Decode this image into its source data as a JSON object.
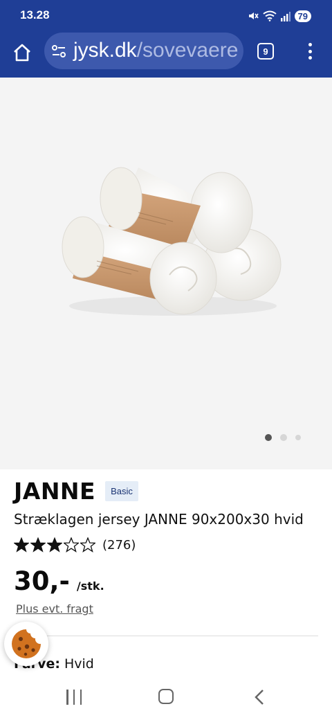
{
  "status_bar": {
    "time": "13.28",
    "battery": "79",
    "icons": [
      "mute-icon",
      "wifi-icon",
      "signal-icon",
      "battery-icon"
    ]
  },
  "browser": {
    "url_domain": "jysk.dk",
    "url_path": "/sovevaere",
    "tab_count": "9",
    "icons": [
      "home-icon",
      "site-settings-icon",
      "tabs-icon",
      "more-menu-icon"
    ],
    "bar_color": "#1f3e96"
  },
  "gallery": {
    "image_alt": "product-photo-rolled-sheets",
    "slide_count": 3,
    "active_slide": 1
  },
  "product": {
    "name": "JANNE",
    "badge": "Basic",
    "description": "Stræklagen jersey JANNE 90x200x30 hvid",
    "rating": 3,
    "rating_max": 5,
    "review_count": "(276)",
    "price": "30,-",
    "unit": "/stk.",
    "shipping_note": "Plus evt. fragt",
    "color_label": "Farve:",
    "color_value": "Hvid"
  },
  "cookie_button": {
    "icon": "cookie-icon"
  },
  "nav_bar": {
    "icons": [
      "recents-icon",
      "home-nav-icon",
      "back-icon"
    ]
  }
}
